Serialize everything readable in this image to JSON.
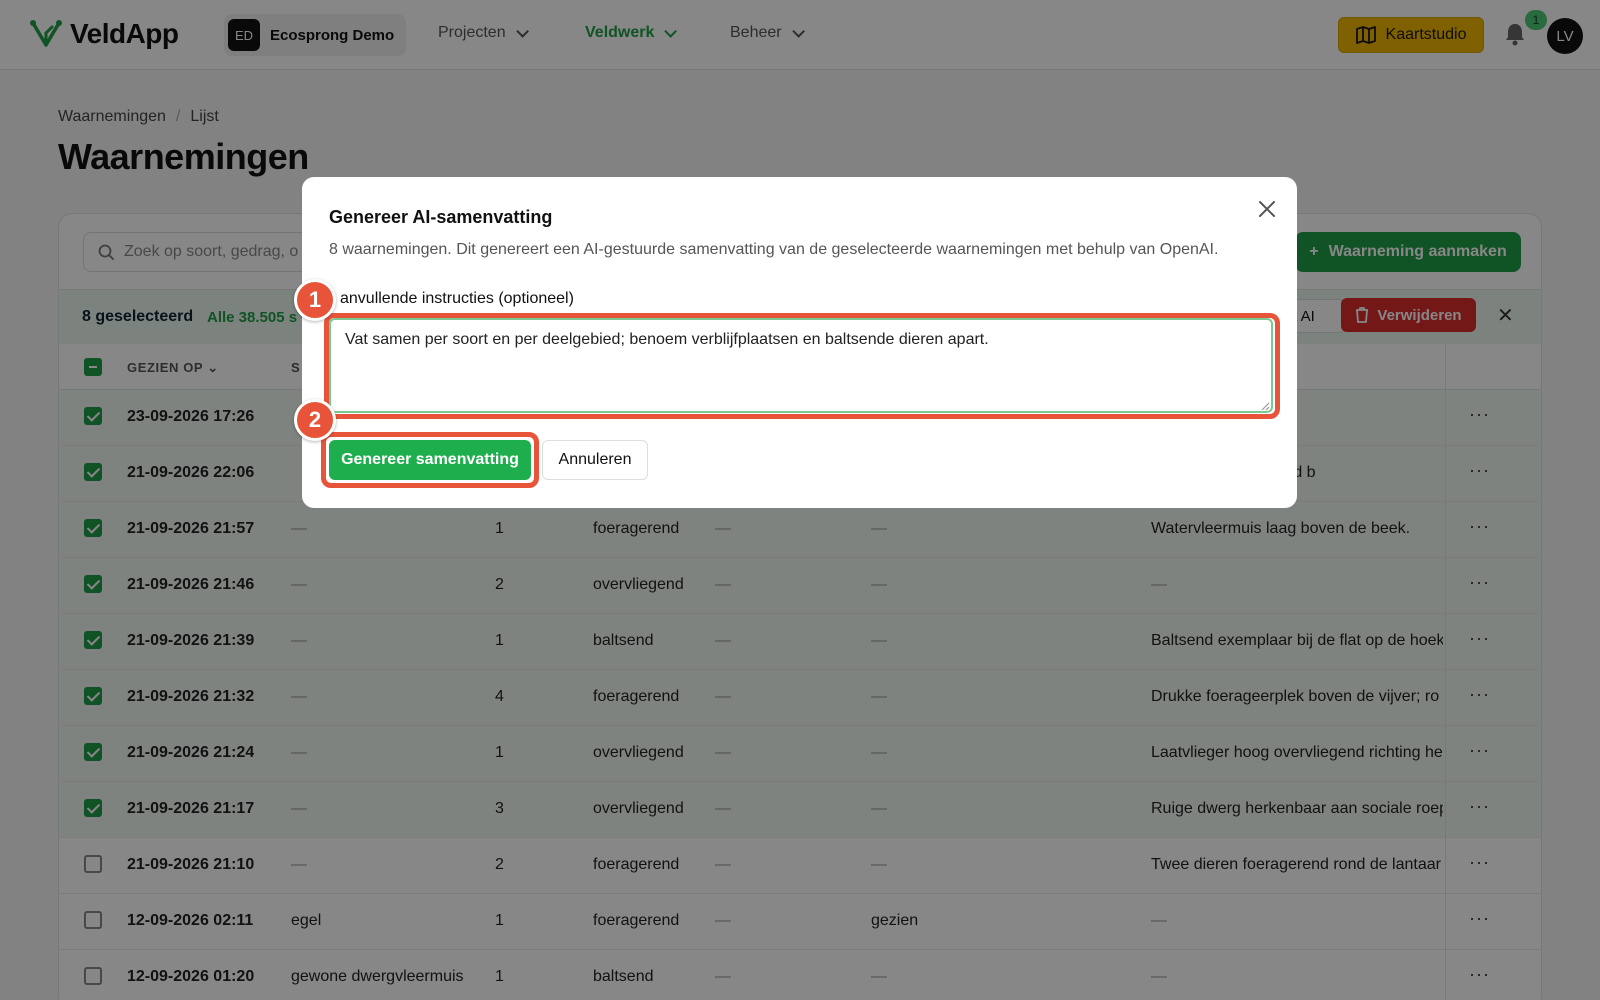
{
  "app": {
    "name": "VeldApp"
  },
  "org": {
    "initials": "ED",
    "name": "Ecosprong Demo"
  },
  "nav": [
    {
      "label": "Projecten",
      "active": false
    },
    {
      "label": "Veldwerk",
      "active": true
    },
    {
      "label": "Beheer",
      "active": false
    }
  ],
  "header_actions": {
    "map_studio": "Kaartstudio",
    "notifications_count": "1",
    "user_initials": "LV"
  },
  "breadcrumb": [
    "Waarnemingen",
    "Lijst"
  ],
  "page": {
    "title": "Waarnemingen"
  },
  "toolbar": {
    "search_placeholder": "Zoek op soort, gedrag, o",
    "create_label": "Waarneming aanmaken"
  },
  "selection": {
    "count_label": "8 geselecteerd",
    "select_all_label": "Alle 38.505 s",
    "ai_label": "t AI",
    "delete_label": "Verwijderen"
  },
  "table": {
    "headers": {
      "seen_at": "GEZIEN OP",
      "species": "S"
    },
    "rows": [
      {
        "selected": true,
        "date": "23-09-2026 17:26",
        "species": "",
        "count": "",
        "behavior": "",
        "c5": "",
        "c6": "",
        "note": ""
      },
      {
        "selected": true,
        "date": "21-09-2026 22:06",
        "species": "",
        "count": "",
        "behavior": "",
        "c5": "",
        "c6": "",
        "note": "atvlieger foeragerend b"
      },
      {
        "selected": true,
        "date": "21-09-2026 21:57",
        "species": "—",
        "count": "1",
        "behavior": "foeragerend",
        "c5": "—",
        "c6": "—",
        "note": "Watervleermuis laag boven de beek."
      },
      {
        "selected": true,
        "date": "21-09-2026 21:46",
        "species": "—",
        "count": "2",
        "behavior": "overvliegend",
        "c5": "—",
        "c6": "—",
        "note": "—"
      },
      {
        "selected": true,
        "date": "21-09-2026 21:39",
        "species": "—",
        "count": "1",
        "behavior": "baltsend",
        "c5": "—",
        "c6": "—",
        "note": "Baltsend exemplaar bij de flat op de hoek"
      },
      {
        "selected": true,
        "date": "21-09-2026 21:32",
        "species": "—",
        "count": "4",
        "behavior": "foeragerend",
        "c5": "—",
        "c6": "—",
        "note": "Drukke foerageerplek boven de vijver; ro"
      },
      {
        "selected": true,
        "date": "21-09-2026 21:24",
        "species": "—",
        "count": "1",
        "behavior": "overvliegend",
        "c5": "—",
        "c6": "—",
        "note": "Laatvlieger hoog overvliegend richting he"
      },
      {
        "selected": true,
        "date": "21-09-2026 21:17",
        "species": "—",
        "count": "3",
        "behavior": "overvliegend",
        "c5": "—",
        "c6": "—",
        "note": "Ruige dwerg herkenbaar aan sociale roep"
      },
      {
        "selected": false,
        "date": "21-09-2026 21:10",
        "species": "—",
        "count": "2",
        "behavior": "foeragerend",
        "c5": "—",
        "c6": "—",
        "note": "Twee dieren foeragerend rond de lantaar"
      },
      {
        "selected": false,
        "date": "12-09-2026 02:11",
        "species": "egel",
        "count": "1",
        "behavior": "foeragerend",
        "c5": "—",
        "c6": "gezien",
        "note": "—"
      },
      {
        "selected": false,
        "date": "12-09-2026 01:20",
        "species": "gewone dwergvleermuis",
        "count": "1",
        "behavior": "baltsend",
        "c5": "—",
        "c6": "—",
        "note": "—"
      }
    ]
  },
  "modal": {
    "title": "Genereer AI-samenvatting",
    "description": "8 waarnemingen. Dit genereert een AI-gestuurde samenvatting van de geselecteerde waarnemingen met behulp van OpenAI.",
    "field_label": "anvullende instructies (optioneel)",
    "field_value": "Vat samen per soort en per deelgebied; benoem verblijfplaatsen en baltsende dieren apart.",
    "generate_label": "Genereer samenvatting",
    "cancel_label": "Annuleren"
  },
  "markers": [
    "1",
    "2"
  ],
  "colors": {
    "accent": "#1f9d47",
    "highlight": "#e8543a",
    "danger": "#d92d2d",
    "map_button": "#f2b705"
  }
}
